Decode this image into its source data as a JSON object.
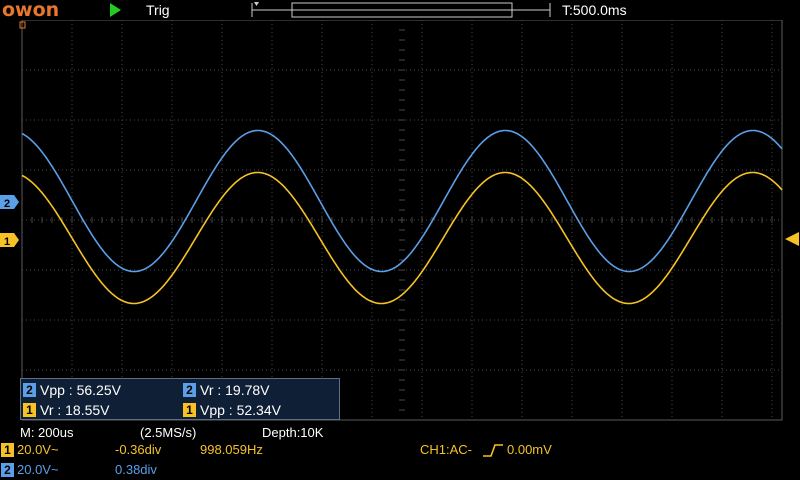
{
  "brand": {
    "logo_text": "owon"
  },
  "header": {
    "trigger_status": "Trig",
    "timebase": "T:500.0ms"
  },
  "channel_markers": {
    "ch1": "1",
    "ch2": "2"
  },
  "measurements": [
    {
      "channel": "2",
      "label": "Vpp : 56.25V"
    },
    {
      "channel": "2",
      "label": "Vr : 19.78V"
    },
    {
      "channel": "1",
      "label": "Vr : 18.55V"
    },
    {
      "channel": "1",
      "label": "Vpp : 52.34V"
    }
  ],
  "horizontal": {
    "scale": "M: 200us",
    "sample_rate": "(2.5MS/s)",
    "depth": "Depth:10K"
  },
  "channels": [
    {
      "badge": "1",
      "volts": "20.0V~",
      "offset": "-0.36div",
      "frequency": "998.059Hz",
      "trigger": "CH1:AC-",
      "trigger_level": "0.00mV"
    },
    {
      "badge": "2",
      "volts": "20.0V~",
      "offset": "0.38div"
    }
  ],
  "colors": {
    "ch1": "#f6c226",
    "ch2": "#5a9fe8",
    "logo": "#e8762b",
    "run": "#22cc22",
    "grid": "#4a4a4a"
  },
  "icons": {
    "run": "play-triangle-icon",
    "trigger_edge": "rising-edge-icon"
  },
  "chart_data": {
    "type": "line",
    "x_unit": "div",
    "xlim": [
      0,
      15.2
    ],
    "ylim": [
      -4,
      4
    ],
    "grid": true,
    "series": [
      {
        "channel": "1",
        "amplitude_div": 1.31,
        "offset_div": -0.36,
        "period_div": 4.95,
        "phase_start_div": 1.0
      },
      {
        "channel": "2",
        "amplitude_div": 1.41,
        "offset_div": 0.38,
        "period_div": 4.95,
        "phase_start_div": -1.47
      }
    ]
  }
}
